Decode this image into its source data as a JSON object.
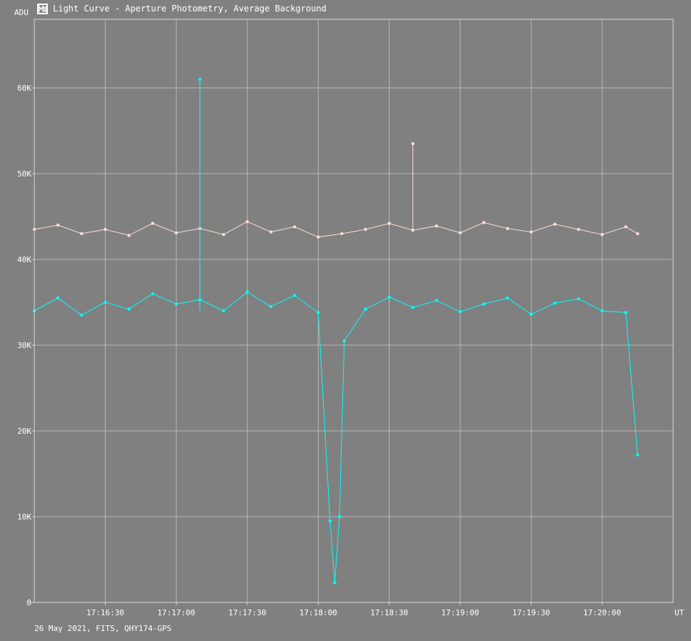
{
  "window": {
    "title": "Light Curve - Aperture Photometry, Average Background",
    "icon": "light-curve-app-icon"
  },
  "footer": {
    "text": "26 May 2021, FITS, QHY174-GPS"
  },
  "chart_data": {
    "type": "line",
    "title": "Light Curve - Aperture Photometry, Average Background",
    "ylabel": "ADU",
    "xlabel": "UT",
    "ylim": [
      0,
      68000
    ],
    "xlim": [
      "17:16:00",
      "17:20:30"
    ],
    "y_ticks": [
      "0",
      "10K",
      "20K",
      "30K",
      "40K",
      "50K",
      "60K"
    ],
    "y_tick_values": [
      0,
      10000,
      20000,
      30000,
      40000,
      50000,
      60000
    ],
    "x_ticks": [
      "17:16:30",
      "17:17:00",
      "17:17:30",
      "17:18:00",
      "17:18:30",
      "17:19:00",
      "17:19:30",
      "17:20:00"
    ],
    "grid": true,
    "line_style": "lines with point markers",
    "colors": {
      "background": "#808080",
      "grid": "#b8b8b8",
      "axis": "#d8d8d8"
    },
    "series": [
      {
        "color": "#ffdcd6",
        "x": [
          "17:16:00",
          "17:16:10",
          "17:16:20",
          "17:16:30",
          "17:16:40",
          "17:16:50",
          "17:17:00",
          "17:17:10",
          "17:17:20",
          "17:17:30",
          "17:17:40",
          "17:17:50",
          "17:18:00",
          "17:18:10",
          "17:18:20",
          "17:18:30",
          "17:18:40",
          "17:18:50",
          "17:19:00",
          "17:19:10",
          "17:19:20",
          "17:19:30",
          "17:19:40",
          "17:19:50",
          "17:20:00",
          "17:20:10",
          "17:20:15"
        ],
        "values": [
          43500,
          44000,
          43000,
          43500,
          42800,
          44200,
          43100,
          43600,
          42900,
          44400,
          43200,
          43800,
          42600,
          43000,
          43500,
          44200,
          43400,
          43900,
          43100,
          44300,
          43600,
          43200,
          44100,
          43500,
          42900,
          43800,
          43000
        ],
        "y_min": 36000,
        "y_max": 53500,
        "peak": {
          "x": "17:18:40",
          "y": 53500
        }
      },
      {
        "color": "#00ffff",
        "x": [
          "17:16:00",
          "17:16:10",
          "17:16:20",
          "17:16:30",
          "17:16:40",
          "17:16:50",
          "17:17:00",
          "17:17:10",
          "17:17:20",
          "17:17:30",
          "17:17:40",
          "17:17:50",
          "17:18:00",
          "17:18:05",
          "17:18:07",
          "17:18:09",
          "17:18:11",
          "17:18:20",
          "17:18:30",
          "17:18:40",
          "17:18:50",
          "17:19:00",
          "17:19:10",
          "17:19:20",
          "17:19:30",
          "17:19:40",
          "17:19:50",
          "17:20:00",
          "17:20:10",
          "17:20:15"
        ],
        "values": [
          34000,
          35500,
          33500,
          35000,
          34200,
          36000,
          34800,
          35300,
          34000,
          36200,
          34500,
          35800,
          33800,
          9500,
          2300,
          10000,
          30500,
          34200,
          35600,
          34400,
          35200,
          33900,
          34800,
          35500,
          33600,
          34900,
          35400,
          34000,
          33800,
          17200
        ],
        "y_min": 2300,
        "y_max": 61000,
        "peak": {
          "x": "17:17:10",
          "y": 61000
        },
        "dip": {
          "x_start": "17:18:05",
          "x_end": "17:18:11",
          "y_min": 2300
        }
      }
    ]
  }
}
